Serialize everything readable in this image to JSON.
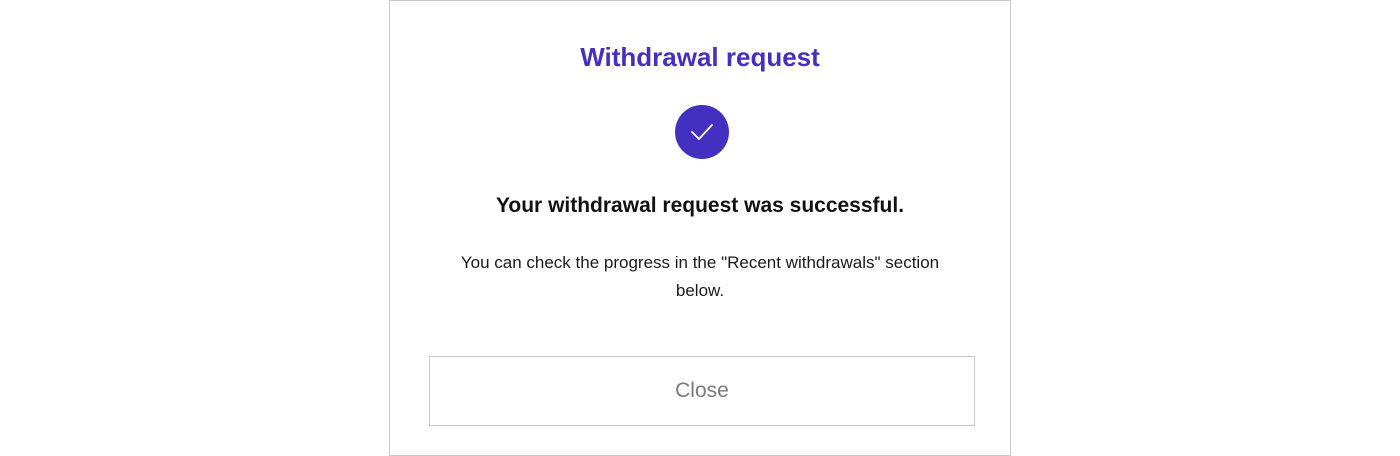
{
  "dialog": {
    "title": "Withdrawal request",
    "status_icon": "check-icon",
    "headline": "Your withdrawal request was successful.",
    "message": "You can check the progress in the \"Recent withdrawals\" section below.",
    "close_label": "Close"
  },
  "colors": {
    "accent": "#4430c0",
    "border": "#c9c9c9",
    "button_text": "#7a7a7a"
  }
}
